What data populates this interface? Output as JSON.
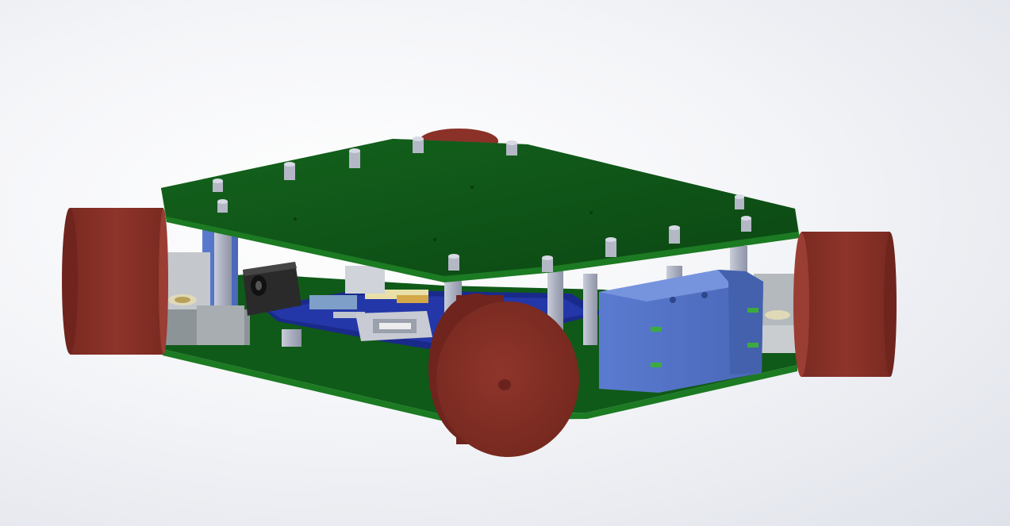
{
  "scene": {
    "type": "3d-cad-render",
    "subject": "robot-chassis-assembly",
    "colors": {
      "background_center": "#ffffff",
      "background_edge": "#dfe2ea",
      "pcb_top": "#0d5417",
      "pcb_edge": "#1b7a22",
      "wheel_face": "#8a3128",
      "wheel_side": "#6f241e",
      "wheel_highlight": "#a0443a",
      "standoff": "#b8bccb",
      "blue_bracket": "#5f7fcf",
      "blue_dark": "#4461ad",
      "motor_grey": "#9aa1a6",
      "jack_black": "#2a2a2a",
      "inner_board": "#1a2a8a"
    },
    "components": [
      "top-pcb-plate",
      "bottom-pcb-plate",
      "left-wheel",
      "right-wheel",
      "front-caster-wheel",
      "rear-wheel",
      "motor-mount-bracket",
      "dc-power-jack",
      "usb-port",
      "standoffs"
    ]
  }
}
